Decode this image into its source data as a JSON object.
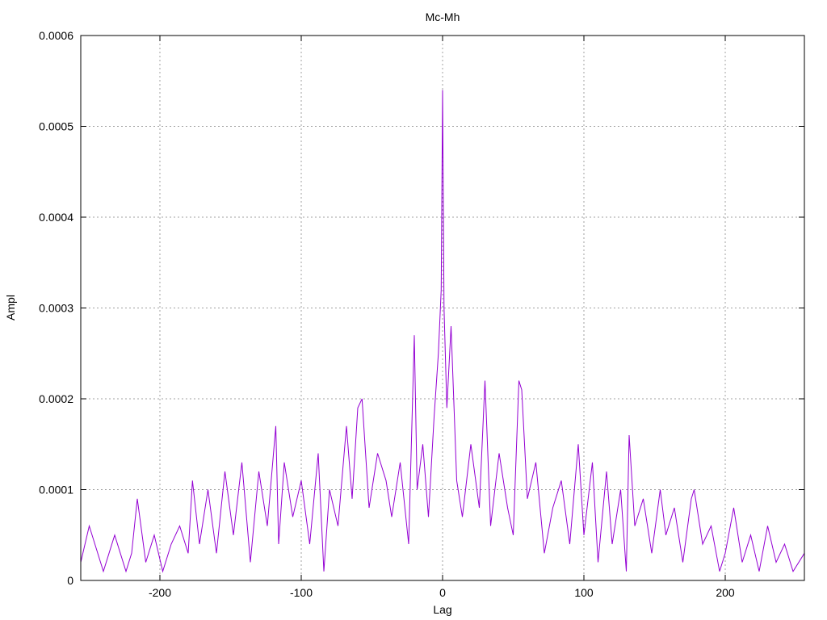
{
  "chart_data": {
    "type": "line",
    "title": "Mc-Mh",
    "xlabel": "Lag",
    "ylabel": "Ampl",
    "xlim": [
      -256,
      256
    ],
    "ylim": [
      0,
      0.0006
    ],
    "grid": true,
    "line_color": "#9400d3",
    "x_ticks": [
      -200,
      -100,
      0,
      100,
      200
    ],
    "x_tick_labels": [
      "-200",
      "-100",
      "0",
      "100",
      "200"
    ],
    "y_ticks": [
      0,
      0.0001,
      0.0002,
      0.0003,
      0.0004,
      0.0005,
      0.0006
    ],
    "y_tick_labels": [
      "0",
      "0.0001",
      "0.0002",
      "0.0003",
      "0.0004",
      "0.0005",
      "0.0006"
    ],
    "series": [
      {
        "x": [
          -256,
          -250,
          -240,
          -232,
          -224,
          -220,
          -216,
          -210,
          -204,
          -198,
          -192,
          -186,
          -180,
          -177,
          -172,
          -166,
          -160,
          -154,
          -148,
          -142,
          -136,
          -130,
          -124,
          -118,
          -116,
          -112,
          -106,
          -100,
          -94,
          -88,
          -84,
          -80,
          -74,
          -68,
          -64,
          -60,
          -57,
          -52,
          -46,
          -40,
          -36,
          -30,
          -24,
          -20,
          -18,
          -14,
          -10,
          -6,
          -3,
          -1,
          0,
          1,
          3,
          6,
          10,
          14,
          20,
          26,
          30,
          34,
          40,
          46,
          50,
          54,
          56,
          60,
          66,
          72,
          78,
          84,
          90,
          96,
          100,
          106,
          110,
          116,
          120,
          126,
          130,
          132,
          136,
          142,
          148,
          154,
          158,
          164,
          170,
          176,
          178,
          184,
          190,
          196,
          200,
          206,
          212,
          218,
          224,
          230,
          236,
          242,
          248,
          256
        ],
        "y": [
          2e-05,
          6e-05,
          1e-05,
          5e-05,
          1e-05,
          3e-05,
          9e-05,
          2e-05,
          5e-05,
          1e-05,
          4e-05,
          6e-05,
          3e-05,
          0.00011,
          4e-05,
          0.0001,
          3e-05,
          0.00012,
          5e-05,
          0.00013,
          2e-05,
          0.00012,
          6e-05,
          0.00017,
          4e-05,
          0.00013,
          7e-05,
          0.00011,
          4e-05,
          0.00014,
          1e-05,
          0.0001,
          6e-05,
          0.00017,
          9e-05,
          0.00019,
          0.0002,
          8e-05,
          0.00014,
          0.00011,
          7e-05,
          0.00013,
          4e-05,
          0.00027,
          0.0001,
          0.00015,
          7e-05,
          0.00018,
          0.00025,
          0.00032,
          0.00054,
          0.0003,
          0.00019,
          0.00028,
          0.00011,
          7e-05,
          0.00015,
          8e-05,
          0.00022,
          6e-05,
          0.00014,
          8e-05,
          5e-05,
          0.00022,
          0.00021,
          9e-05,
          0.00013,
          3e-05,
          8e-05,
          0.00011,
          4e-05,
          0.00015,
          5e-05,
          0.00013,
          2e-05,
          0.00012,
          4e-05,
          0.0001,
          1e-05,
          0.00016,
          6e-05,
          9e-05,
          3e-05,
          0.0001,
          5e-05,
          8e-05,
          2e-05,
          9e-05,
          0.0001,
          4e-05,
          6e-05,
          1e-05,
          3e-05,
          8e-05,
          2e-05,
          5e-05,
          1e-05,
          6e-05,
          2e-05,
          4e-05,
          1e-05,
          3e-05
        ]
      }
    ]
  }
}
